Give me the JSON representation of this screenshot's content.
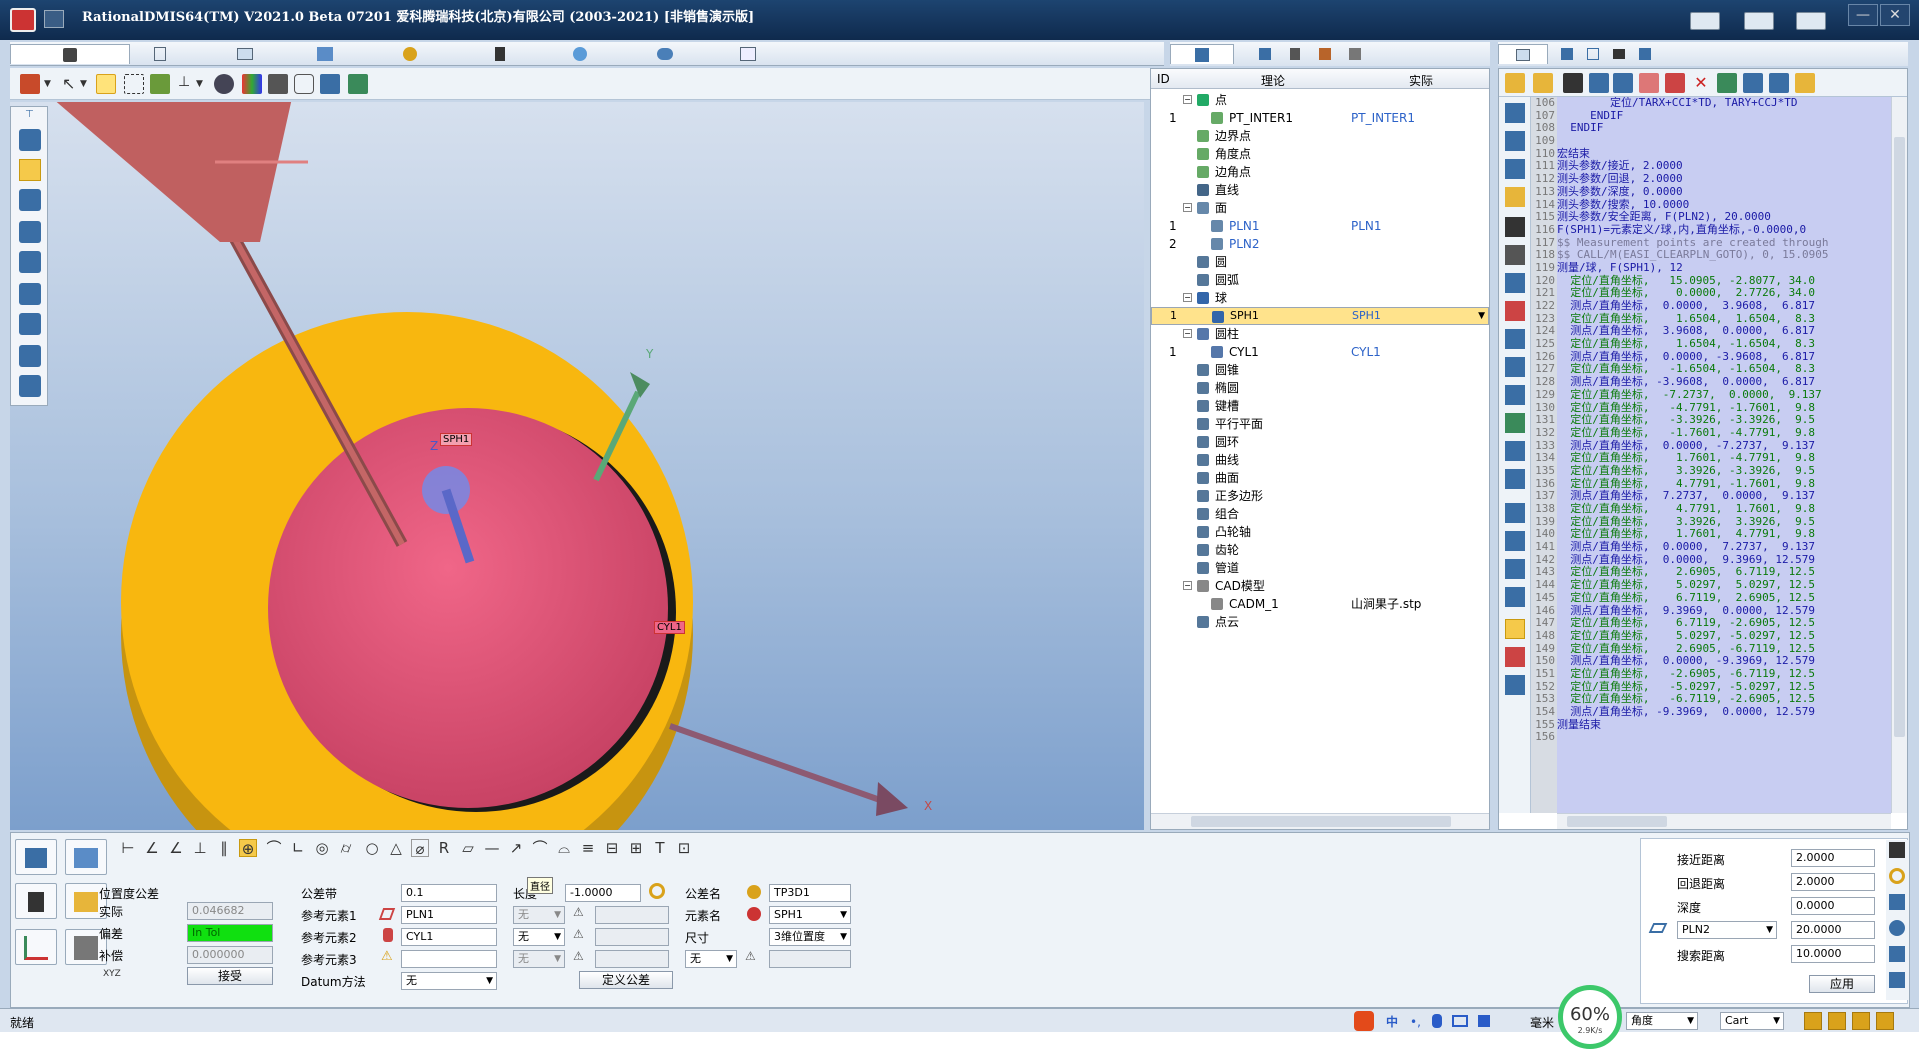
{
  "window": {
    "title": "RationalDMIS64(TM) V2021.0 Beta 07201   爱科腾瑞科技(北京)有限公司 (2003-2021) [非销售演示版]"
  },
  "viewport": {
    "labels": {
      "y": "Y",
      "z": "Z",
      "x": "X",
      "sph1": "SPH1",
      "cyl1": "CYL1"
    }
  },
  "tree": {
    "headers": {
      "id": "ID",
      "nominal": "理论",
      "actual": "实际"
    },
    "rows": [
      {
        "id": "",
        "exp": "⊟",
        "name": "点",
        "act": "",
        "level": 0,
        "color": "#2a6"
      },
      {
        "id": "1",
        "exp": "",
        "name": "PT_INTER1",
        "act": "PT_INTER1",
        "level": 1,
        "color": "#6a6"
      },
      {
        "id": "",
        "exp": "",
        "name": "边界点",
        "act": "",
        "level": 0,
        "color": "#6a6"
      },
      {
        "id": "",
        "exp": "",
        "name": "角度点",
        "act": "",
        "level": 0,
        "color": "#6a6"
      },
      {
        "id": "",
        "exp": "",
        "name": "边角点",
        "act": "",
        "level": 0,
        "color": "#6a6"
      },
      {
        "id": "",
        "exp": "",
        "name": "直线",
        "act": "",
        "level": 0,
        "color": "#468"
      },
      {
        "id": "",
        "exp": "⊟",
        "name": "面",
        "act": "",
        "level": 0,
        "color": "#68a"
      },
      {
        "id": "1",
        "exp": "",
        "name": "PLN1",
        "act": "PLN1",
        "level": 1,
        "color": "#68a",
        "blue": true
      },
      {
        "id": "2",
        "exp": "",
        "name": "PLN2",
        "act": "",
        "level": 1,
        "color": "#68a",
        "blue": true
      },
      {
        "id": "",
        "exp": "",
        "name": "圆",
        "act": "",
        "level": 0,
        "color": "#579"
      },
      {
        "id": "",
        "exp": "",
        "name": "圆弧",
        "act": "",
        "level": 0,
        "color": "#579"
      },
      {
        "id": "",
        "exp": "⊟",
        "name": "球",
        "act": "",
        "level": 0,
        "color": "#36a"
      },
      {
        "id": "1",
        "exp": "",
        "name": "SPH1",
        "act": "SPH1",
        "level": 1,
        "color": "#36a",
        "sel": true
      },
      {
        "id": "",
        "exp": "⊟",
        "name": "圆柱",
        "act": "",
        "level": 0,
        "color": "#57a"
      },
      {
        "id": "1",
        "exp": "",
        "name": "CYL1",
        "act": "CYL1",
        "level": 1,
        "color": "#57a"
      },
      {
        "id": "",
        "exp": "",
        "name": "圆锥",
        "act": "",
        "level": 0,
        "color": "#579"
      },
      {
        "id": "",
        "exp": "",
        "name": "椭圆",
        "act": "",
        "level": 0,
        "color": "#579"
      },
      {
        "id": "",
        "exp": "",
        "name": "键槽",
        "act": "",
        "level": 0,
        "color": "#579"
      },
      {
        "id": "",
        "exp": "",
        "name": "平行平面",
        "act": "",
        "level": 0,
        "color": "#579"
      },
      {
        "id": "",
        "exp": "",
        "name": "圆环",
        "act": "",
        "level": 0,
        "color": "#579"
      },
      {
        "id": "",
        "exp": "",
        "name": "曲线",
        "act": "",
        "level": 0,
        "color": "#579"
      },
      {
        "id": "",
        "exp": "",
        "name": "曲面",
        "act": "",
        "level": 0,
        "color": "#579"
      },
      {
        "id": "",
        "exp": "",
        "name": "正多边形",
        "act": "",
        "level": 0,
        "color": "#579"
      },
      {
        "id": "",
        "exp": "",
        "name": "组合",
        "act": "",
        "level": 0,
        "color": "#579"
      },
      {
        "id": "",
        "exp": "",
        "name": "凸轮轴",
        "act": "",
        "level": 0,
        "color": "#579"
      },
      {
        "id": "",
        "exp": "",
        "name": "齿轮",
        "act": "",
        "level": 0,
        "color": "#579"
      },
      {
        "id": "",
        "exp": "",
        "name": "管道",
        "act": "",
        "level": 0,
        "color": "#579"
      },
      {
        "id": "",
        "exp": "⊟",
        "name": "CAD模型",
        "act": "",
        "level": 0,
        "color": "#888"
      },
      {
        "id": "",
        "exp": "",
        "name": "CADM_1",
        "act": "山涧果子.stp",
        "level": 1,
        "color": "#888"
      },
      {
        "id": "",
        "exp": "",
        "name": "点云",
        "act": "",
        "level": 0,
        "color": "#579"
      }
    ]
  },
  "code": {
    "lines": [
      {
        "n": "106",
        "t": "        定位/TARX+CCI*TD, TARY+CCJ*TD",
        "c": "b"
      },
      {
        "n": "107",
        "t": "     ENDIF",
        "c": "b"
      },
      {
        "n": "108",
        "t": "  ENDIF",
        "c": "b"
      },
      {
        "n": "109",
        "t": "",
        "c": "b"
      },
      {
        "n": "110",
        "t": "宏结束",
        "c": "b"
      },
      {
        "n": "111",
        "t": "测头参数/接近, 2.0000",
        "c": "b"
      },
      {
        "n": "112",
        "t": "测头参数/回退, 2.0000",
        "c": "b"
      },
      {
        "n": "113",
        "t": "测头参数/深度, 0.0000",
        "c": "b"
      },
      {
        "n": "114",
        "t": "测头参数/搜索, 10.0000",
        "c": "b"
      },
      {
        "n": "115",
        "t": "测头参数/安全距离, F(PLN2), 20.0000",
        "c": "b"
      },
      {
        "n": "116",
        "t": "F(SPH1)=元素定义/球,内,直角坐标,-0.0000,0",
        "c": "b"
      },
      {
        "n": "117",
        "t": "$$ Measurement points are created through",
        "c": "c"
      },
      {
        "n": "118",
        "t": "$$ CALL/M(EASI_CLEARPLN_GOTO), 0, 15.0905",
        "c": "c"
      },
      {
        "n": "119",
        "t": "测量/球, F(SPH1), 12",
        "c": "b"
      },
      {
        "n": "120",
        "t": "  定位/直角坐标,   15.0905, -2.8077, 34.0",
        "c": "g"
      },
      {
        "n": "121",
        "t": "  定位/直角坐标,    0.0000,  2.7726, 34.0",
        "c": "g"
      },
      {
        "n": "122",
        "t": "  测点/直角坐标,  0.0000,  3.9608,  6.817",
        "c": "b"
      },
      {
        "n": "123",
        "t": "  定位/直角坐标,    1.6504,  1.6504,  8.3",
        "c": "g"
      },
      {
        "n": "124",
        "t": "  测点/直角坐标,  3.9608,  0.0000,  6.817",
        "c": "b"
      },
      {
        "n": "125",
        "t": "  定位/直角坐标,    1.6504, -1.6504,  8.3",
        "c": "g"
      },
      {
        "n": "126",
        "t": "  测点/直角坐标,  0.0000, -3.9608,  6.817",
        "c": "b"
      },
      {
        "n": "127",
        "t": "  定位/直角坐标,   -1.6504, -1.6504,  8.3",
        "c": "g"
      },
      {
        "n": "128",
        "t": "  测点/直角坐标, -3.9608,  0.0000,  6.817",
        "c": "b"
      },
      {
        "n": "129",
        "t": "  定位/直角坐标,  -7.2737,  0.0000,  9.137",
        "c": "g"
      },
      {
        "n": "130",
        "t": "  定位/直角坐标,   -4.7791, -1.7601,  9.8",
        "c": "g"
      },
      {
        "n": "131",
        "t": "  定位/直角坐标,   -3.3926, -3.3926,  9.5",
        "c": "g"
      },
      {
        "n": "132",
        "t": "  定位/直角坐标,   -1.7601, -4.7791,  9.8",
        "c": "g"
      },
      {
        "n": "133",
        "t": "  测点/直角坐标,  0.0000, -7.2737,  9.137",
        "c": "b"
      },
      {
        "n": "134",
        "t": "  定位/直角坐标,    1.7601, -4.7791,  9.8",
        "c": "g"
      },
      {
        "n": "135",
        "t": "  定位/直角坐标,    3.3926, -3.3926,  9.5",
        "c": "g"
      },
      {
        "n": "136",
        "t": "  定位/直角坐标,    4.7791, -1.7601,  9.8",
        "c": "g"
      },
      {
        "n": "137",
        "t": "  测点/直角坐标,  7.2737,  0.0000,  9.137",
        "c": "b"
      },
      {
        "n": "138",
        "t": "  定位/直角坐标,    4.7791,  1.7601,  9.8",
        "c": "g"
      },
      {
        "n": "139",
        "t": "  定位/直角坐标,    3.3926,  3.3926,  9.5",
        "c": "g"
      },
      {
        "n": "140",
        "t": "  定位/直角坐标,    1.7601,  4.7791,  9.8",
        "c": "g"
      },
      {
        "n": "141",
        "t": "  测点/直角坐标,  0.0000,  7.2737,  9.137",
        "c": "b"
      },
      {
        "n": "142",
        "t": "  测点/直角坐标,  0.0000,  9.3969, 12.579",
        "c": "b"
      },
      {
        "n": "143",
        "t": "  定位/直角坐标,    2.6905,  6.7119, 12.5",
        "c": "g"
      },
      {
        "n": "144",
        "t": "  定位/直角坐标,    5.0297,  5.0297, 12.5",
        "c": "g"
      },
      {
        "n": "145",
        "t": "  定位/直角坐标,    6.7119,  2.6905, 12.5",
        "c": "g"
      },
      {
        "n": "146",
        "t": "  测点/直角坐标,  9.3969,  0.0000, 12.579",
        "c": "b"
      },
      {
        "n": "147",
        "t": "  定位/直角坐标,    6.7119, -2.6905, 12.5",
        "c": "g"
      },
      {
        "n": "148",
        "t": "  定位/直角坐标,    5.0297, -5.0297, 12.5",
        "c": "g"
      },
      {
        "n": "149",
        "t": "  定位/直角坐标,    2.6905, -6.7119, 12.5",
        "c": "g"
      },
      {
        "n": "150",
        "t": "  测点/直角坐标,  0.0000, -9.3969, 12.579",
        "c": "b"
      },
      {
        "n": "151",
        "t": "  定位/直角坐标,   -2.6905, -6.7119, 12.5",
        "c": "g"
      },
      {
        "n": "152",
        "t": "  定位/直角坐标,   -5.0297, -5.0297, 12.5",
        "c": "g"
      },
      {
        "n": "153",
        "t": "  定位/直角坐标,   -6.7119, -2.6905, 12.5",
        "c": "g"
      },
      {
        "n": "154",
        "t": "  测点/直角坐标, -9.3969,  0.0000, 12.579",
        "c": "b"
      },
      {
        "n": "155",
        "t": "测量结束",
        "c": "b"
      },
      {
        "n": "156",
        "t": "",
        "c": "b"
      }
    ]
  },
  "tol": {
    "title": "位置度公差",
    "actual_label": "实际",
    "actual_value": "0.046682",
    "dev_label": "偏差",
    "dev_value": "In Tol",
    "comp_label": "补偿",
    "comp_value": "0.000000",
    "xyz": "XYZ",
    "accept": "接受",
    "zone_label": "公差带",
    "zone_value": "0.1",
    "ref1_label": "参考元素1",
    "ref1_value": "PLN1",
    "ref2_label": "参考元素2",
    "ref2_value": "CYL1",
    "ref3_label": "参考元素3",
    "ref3_value": "",
    "datum_label": "Datum方法",
    "datum_value": "无",
    "len_label": "长度",
    "len_tooltip": "直径",
    "len_value": "-1.0000",
    "mod1": "无",
    "mod2": "无",
    "mod3": "无",
    "define": "定义公差",
    "tolname_label": "公差名",
    "tolname_value": "TP3D1",
    "elem_label": "元素名",
    "elem_value": "SPH1",
    "size_label": "尺寸",
    "size_value": "3维位置度",
    "size_mod": "无"
  },
  "probe": {
    "approach_label": "接近距离",
    "approach_value": "2.0000",
    "retract_label": "回退距离",
    "retract_value": "2.0000",
    "depth_label": "深度",
    "depth_value": "0.0000",
    "clear_plane": "PLN2",
    "clear_value": "20.0000",
    "search_label": "搜索距离",
    "search_value": "10.0000",
    "apply": "应用"
  },
  "status": {
    "left": "就绪",
    "units": "毫米",
    "angle": "角度",
    "coord": "Cart",
    "perf": "60%",
    "rate": "2.9K/s",
    "ime": "中"
  }
}
